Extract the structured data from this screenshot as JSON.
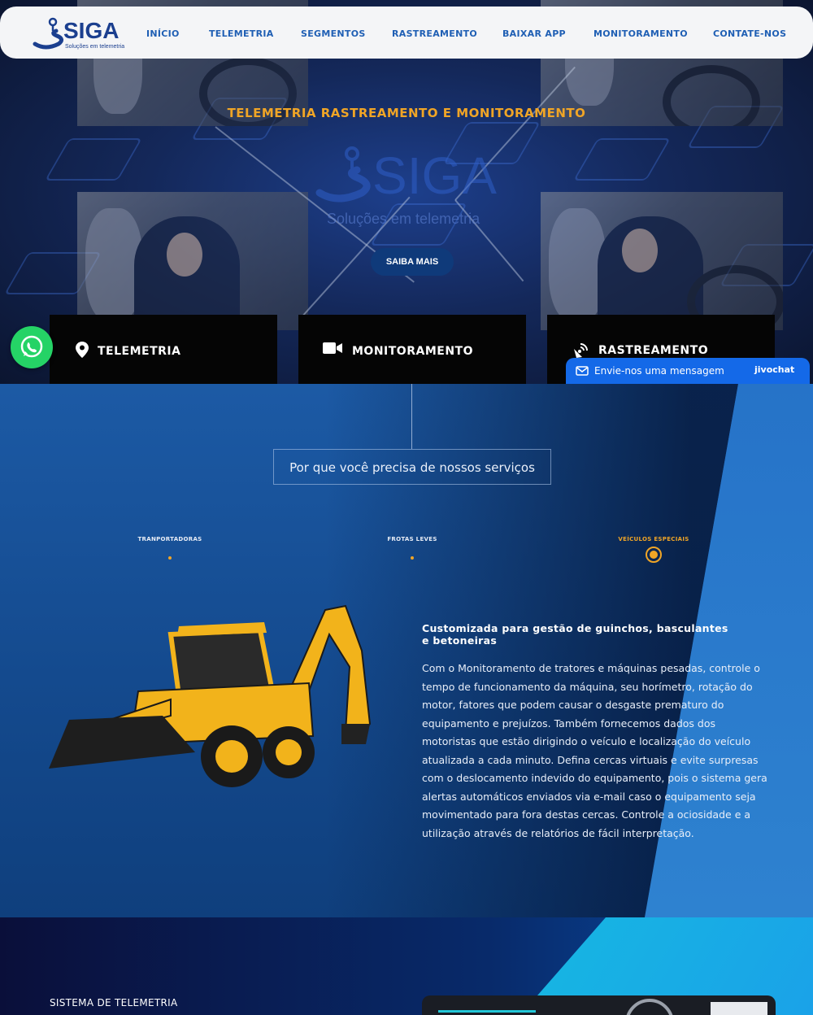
{
  "nav": {
    "logo_name": "SIGA",
    "logo_tagline": "Soluções em telemetria",
    "items": [
      "INÍCIO",
      "TELEMETRIA",
      "SEGMENTOS",
      "RASTREAMENTO",
      "BAIXAR APP",
      "MONITORAMENTO",
      "CONTATE-NOS"
    ]
  },
  "hero": {
    "tagline": "TELEMETRIA RASTREAMENTO E MONITORAMENTO",
    "logo_name": "SIGA",
    "logo_sub": "Soluções em telemetria",
    "button": "SAIBA MAIS"
  },
  "services": [
    {
      "label": "TELEMETRIA",
      "icon": "map-pin-icon"
    },
    {
      "label": "MONITORAMENTO",
      "icon": "video-camera-icon"
    },
    {
      "label": "RASTREAMENTO",
      "icon": "satellite-icon"
    }
  ],
  "whatsapp": {
    "icon": "whatsapp-icon"
  },
  "jivochat": {
    "message": "Envie-nos uma mensagem",
    "brand": "jivochat"
  },
  "why": {
    "title": "Por que você precisa de nossos serviços",
    "tabs": [
      {
        "label": "TRANPORTADORAS",
        "active": false
      },
      {
        "label": "FROTAS LEVES",
        "active": false
      },
      {
        "label": "VEÍCULOS ESPECIAIS",
        "active": true
      }
    ],
    "heading": "Customizada para gestão de guinchos, basculantes e betoneiras",
    "body": "Com o Monitoramento de tratores e máquinas pesadas, controle o tempo de funcionamento da máquina, seu horímetro, rotação do motor, fatores que podem causar o desgaste prematuro do equipamento e prejuízos. Também fornecemos dados dos motoristas que estão dirigindo o veículo e localização do veículo atualizada a cada minuto. Defina cercas virtuais e evite surpresas com o deslocamento indevido do equipamento, pois o sistema gera alertas automáticos enviados via e-mail caso o equipamento seja movimentado para fora destas cercas. Controle a ociosidade e a utilização através de relatórios de fácil interpretação."
  },
  "system": {
    "title": "SISTEMA DE TELEMETRIA"
  },
  "colors": {
    "accent": "#f0a526",
    "brand": "#1b3f8f",
    "nav_text": "#1f5fb4",
    "whatsapp": "#25d366",
    "jivo": "#1469e8"
  }
}
